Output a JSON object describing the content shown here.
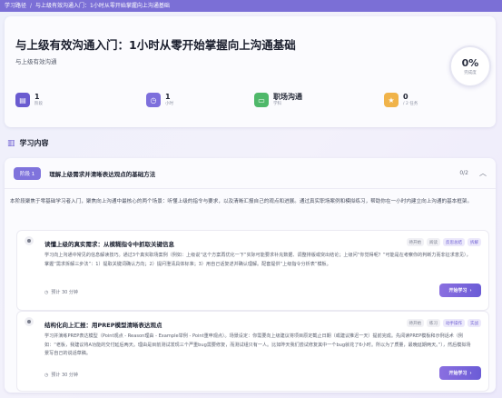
{
  "breadcrumb": {
    "root": "学习路径",
    "separator": "/",
    "current": "与上级有效沟通入门：1小时从零开始掌握向上沟通基础"
  },
  "header": {
    "title": "与上级有效沟通入门：1小时从零开始掌握向上沟通基础",
    "subtitle": "与上级有效沟通",
    "progress": {
      "value": "0%",
      "label": "完成度"
    }
  },
  "stats": [
    {
      "value": "1",
      "label": "阶段",
      "icon": "book-icon",
      "color": "#6a5bd0"
    },
    {
      "value": "1",
      "label": "小时",
      "icon": "clock-icon",
      "color": "#7d6fdc"
    },
    {
      "value": "职场沟通",
      "label": "学科",
      "icon": "folder-icon",
      "color": "#4fb86a"
    },
    {
      "value": "0",
      "label": "/ 2 任务",
      "icon": "trophy-icon",
      "color": "#f0b34a"
    }
  ],
  "section": {
    "title": "学习内容",
    "icon": "books-icon"
  },
  "stage": {
    "badge": "阶段 1",
    "title": "理解上级需求并清晰表达观点的基础方法",
    "count": "0/2",
    "description": "本阶段聚焦于零基础学习者入门，聚焦向上沟通中最核心的两个场景：听懂上级的指令与要求，以及清晰汇报自己的观点和进展。通过真实职场案例和模拟练习，帮助你在一小时内建立向上沟通的基本框架。"
  },
  "tasks": [
    {
      "title": "读懂上级的真实需求：从模糊指令中抓取关键信息",
      "tags": [
        "待开始",
        "阅读",
        "反思总结",
        "拆解"
      ],
      "description": "学习向上沟通中常见的信息解读技巧。通过3个真实职场案例（例如：上级说“这个方案再优化一下”实际可能要求补充数据、调整排版或突出结论；上级问“你觉得呢？”可能是在考察你的判断力而非征求意见），掌握“需求拆解三步法”：1）提取关键词确认方向；2）提问澄清具体标准；3）用自己话复述并确认理解。配套提供“上级指令分析表”模板。",
      "time": "预计 30 分钟",
      "button": "开始学习"
    },
    {
      "title": "结构化向上汇报：用PREP模型清晰表达观点",
      "tags": [
        "待开始",
        "练习",
        "动手操作",
        "实战"
      ],
      "description": "学习并演练PREP表达模型（Point观点 - Reason理由 - Example举例 - Point重申观点）。场景设定：你需要向上级建议将项目原定截止日期（或建议推迟一天）提前完成。先阅读PREP模板和示例话术（例如：“老板，我建议将A功能的交付延后两天。理由是目前测试发现三个严重bug需要修复，而测试组只有一人。比如昨天我们尝试修复其中一个bug就花了6小时。所以为了质量，最晚延期两天。”），然后模拟场景写自己的说话草稿。",
      "time": "预计 30 分钟",
      "button": "开始学习"
    }
  ]
}
